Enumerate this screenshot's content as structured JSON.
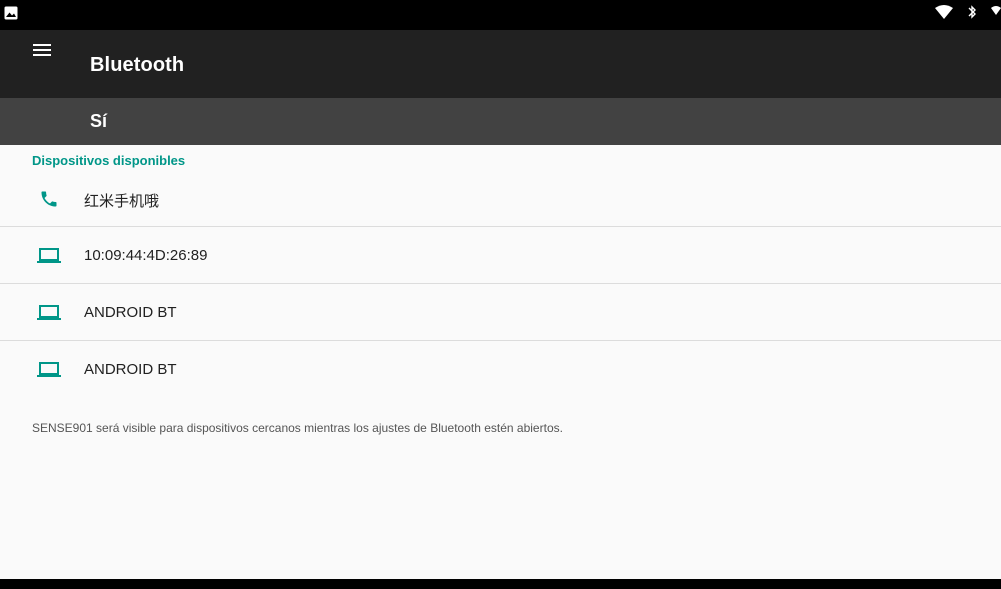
{
  "toolbar": {
    "title": "Bluetooth",
    "menu_icon": "menu-icon"
  },
  "switch": {
    "label": "Sí"
  },
  "section": {
    "header": "Dispositivos disponibles"
  },
  "devices": [
    {
      "name": "红米手机哦",
      "icon": "phone-icon"
    },
    {
      "name": "10:09:44:4D:26:89",
      "icon": "laptop-icon"
    },
    {
      "name": "ANDROID BT",
      "icon": "laptop-icon"
    },
    {
      "name": "ANDROID BT",
      "icon": "laptop-icon"
    }
  ],
  "footer": {
    "text": "SENSE901 será visible para dispositivos cercanos mientras los ajustes de Bluetooth estén abiertos."
  },
  "colors": {
    "accent": "#009688",
    "toolbar": "#212121",
    "switch_bar": "#424242"
  }
}
